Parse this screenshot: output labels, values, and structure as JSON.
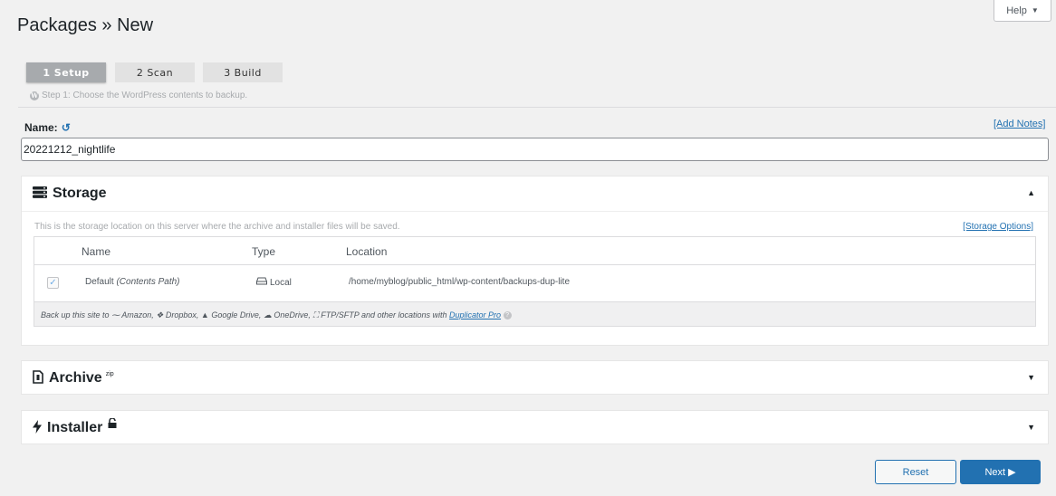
{
  "help": {
    "label": "Help",
    "caret": "▼"
  },
  "page": {
    "title": "Packages » New"
  },
  "steps": [
    {
      "label": "1 Setup"
    },
    {
      "label": "2 Scan"
    },
    {
      "label": "3 Build"
    }
  ],
  "step_description": "Step 1: Choose the WordPress contents to backup.",
  "name_field": {
    "label": "Name:",
    "value": "20221212_nightlife",
    "add_notes": "[Add Notes]"
  },
  "storage": {
    "title": "Storage",
    "description": "This is the storage location on this server where the archive and installer files will be saved.",
    "options_link": "[Storage Options]",
    "columns": [
      "Name",
      "Type",
      "Location"
    ],
    "row": {
      "name": "Default",
      "name_suffix": "(Contents Path)",
      "type": "Local",
      "location": "/home/myblog/public_html/wp-content/backups-dup-lite"
    },
    "promo": {
      "prefix": "Back up this site to",
      "amazon": "Amazon,",
      "dropbox": "Dropbox,",
      "gdrive": "Google Drive,",
      "onedrive": "OneDrive,",
      "ftp": "FTP/SFTP and other locations with",
      "link": "Duplicator Pro"
    }
  },
  "archive": {
    "title": "Archive",
    "tag": "zip"
  },
  "installer": {
    "title": "Installer"
  },
  "buttons": {
    "reset": "Reset",
    "next": "Next"
  },
  "icons": {
    "toggle_open": "▲",
    "toggle_closed": "▼"
  },
  "colors": {
    "accent": "#2271b1",
    "step_active": "#a7aaad",
    "background": "#f1f1f1"
  }
}
